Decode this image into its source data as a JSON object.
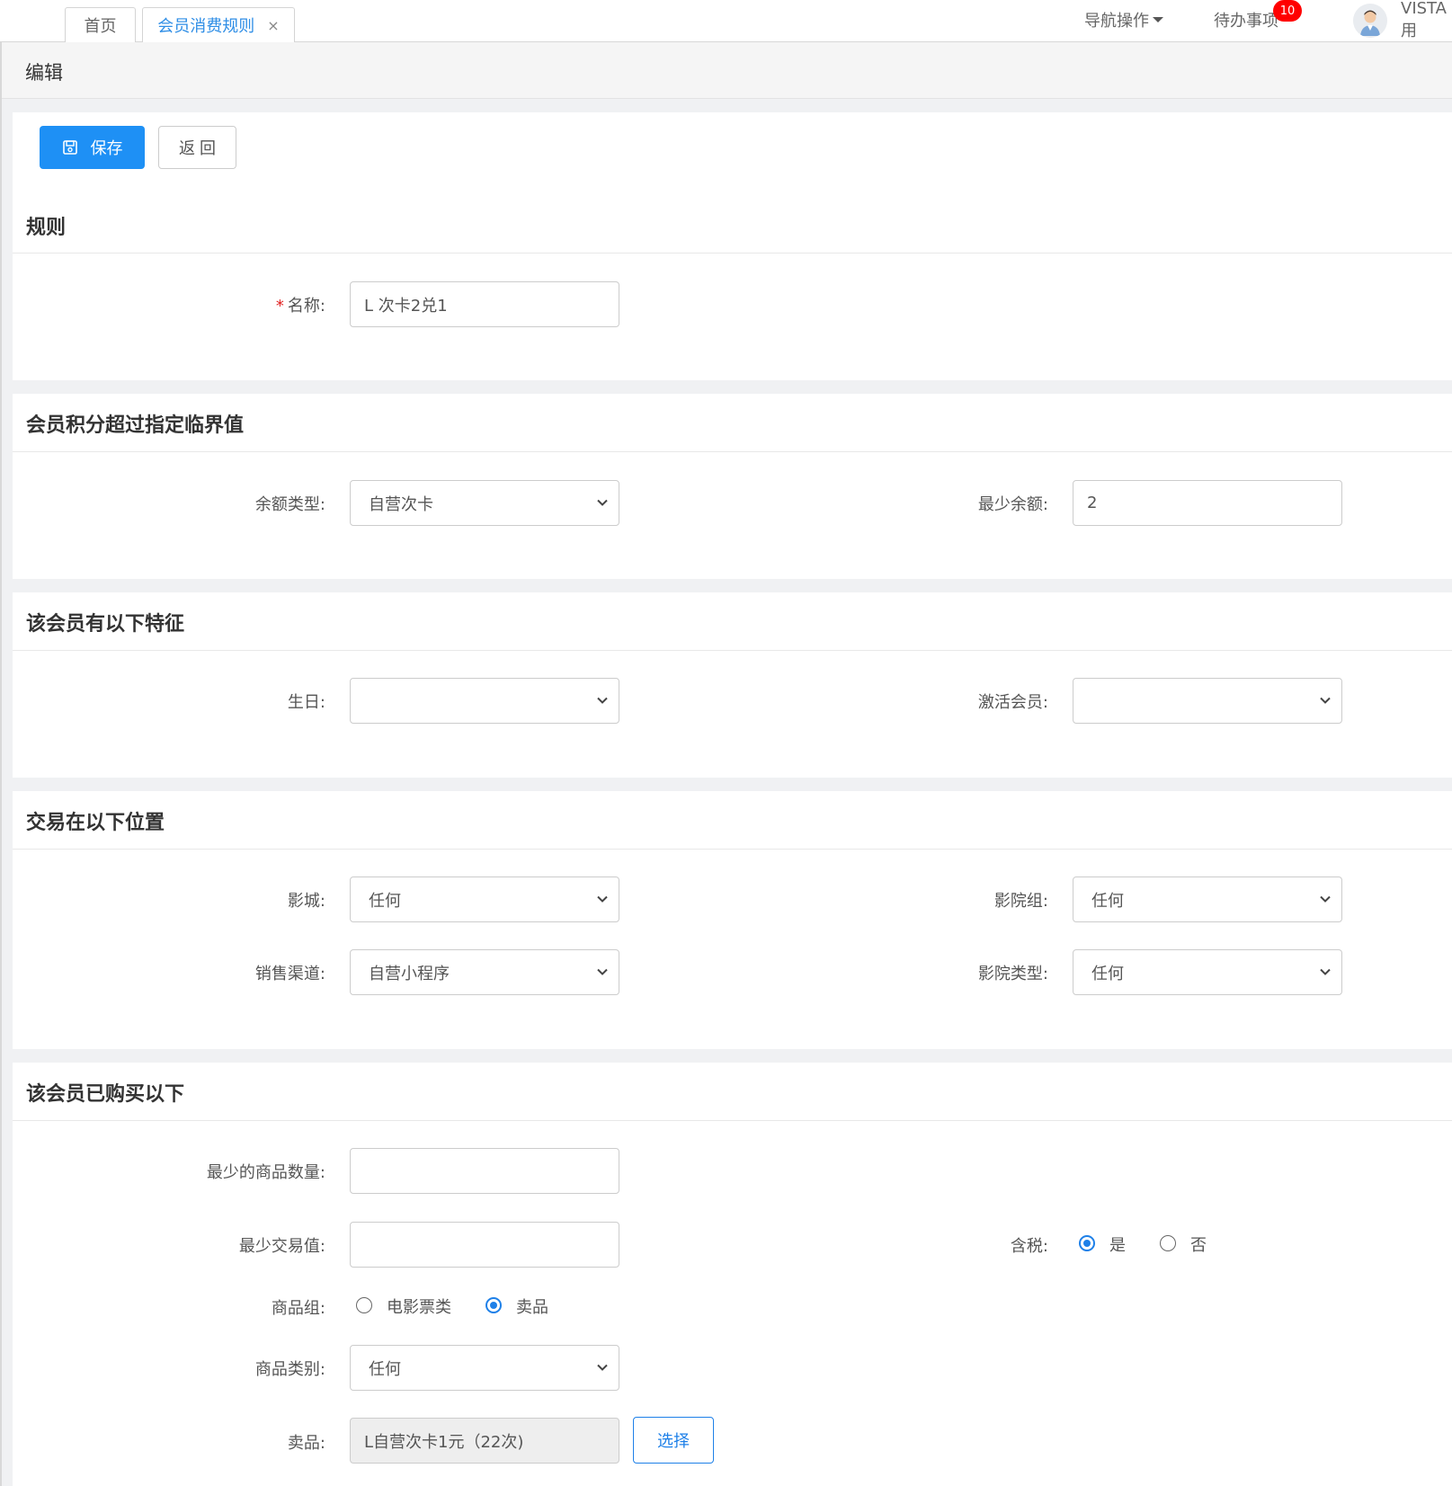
{
  "tabs": [
    {
      "label": "首页"
    },
    {
      "label": "会员消费规则",
      "close": "×"
    }
  ],
  "topnav": {
    "nav_ops": "导航操作",
    "todo": "待办事项",
    "todo_count": "10",
    "user": "VISTA用"
  },
  "page": {
    "title": "编辑"
  },
  "toolbar": {
    "save_label": "保存",
    "back_label": "返 回"
  },
  "sections": {
    "rule": {
      "title": "规则",
      "name_label": "名称:",
      "name_value": "L 次卡2兑1"
    },
    "points": {
      "title": "会员积分超过指定临界值",
      "balance_type_label": "余额类型:",
      "balance_type_value": "自营次卡",
      "min_balance_label": "最少余额:",
      "min_balance_value": "2"
    },
    "features": {
      "title": "该会员有以下特征",
      "birthday_label": "生日:",
      "birthday_value": "",
      "active_label": "激活会员:",
      "active_value": ""
    },
    "location": {
      "title": "交易在以下位置",
      "cinema_label": "影城:",
      "cinema_value": "任何",
      "cinema_group_label": "影院组:",
      "cinema_group_value": "任何",
      "channel_label": "销售渠道:",
      "channel_value": "自营小程序",
      "cinema_type_label": "影院类型:",
      "cinema_type_value": "任何"
    },
    "purchase": {
      "title": "该会员已购买以下",
      "min_qty_label": "最少的商品数量:",
      "min_qty_value": "",
      "min_value_label": "最少交易值:",
      "min_value_value": "",
      "tax_label": "含税:",
      "tax_yes": "是",
      "tax_no": "否",
      "group_label": "商品组:",
      "group_movie": "电影票类",
      "group_goods": "卖品",
      "category_label": "商品类别:",
      "category_value": "任何",
      "goods_label": "卖品:",
      "goods_value": "L自营次卡1元（22次)",
      "select_label": "选择"
    }
  },
  "colors": {
    "primary": "#1e90f5",
    "badge": "#ff0000",
    "required": "#e02020"
  }
}
